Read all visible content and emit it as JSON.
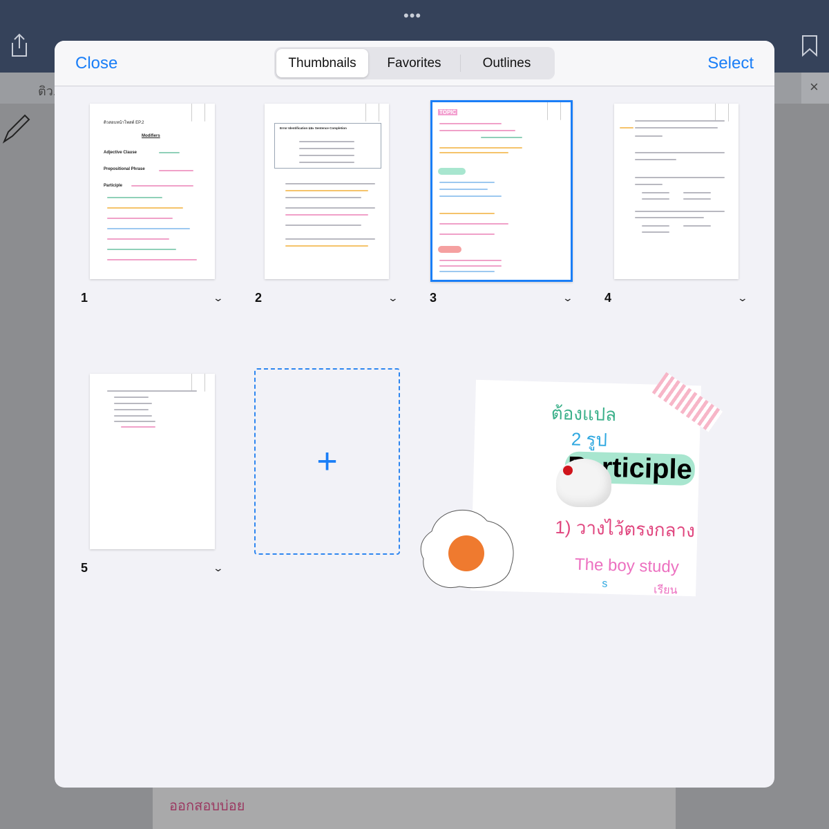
{
  "topbar": {
    "more_icon": "ellipsis-icon",
    "share_icon": "share-icon",
    "bookmark_icon": "bookmark-icon",
    "tab_title": "ติว...",
    "tab_close": "×",
    "doc_text": "ออกสอบบ่อย"
  },
  "modal": {
    "close_label": "Close",
    "select_label": "Select",
    "tabs": [
      {
        "label": "Thumbnails",
        "active": true
      },
      {
        "label": "Favorites",
        "active": false
      },
      {
        "label": "Outlines",
        "active": false
      }
    ],
    "pages": [
      {
        "number": "1",
        "headings": [
          "ติวสอบหน้าโพสต์ EP.2",
          "Modifiers",
          "Adjective Clause",
          "Prepositional Phrase",
          "Participle"
        ]
      },
      {
        "number": "2",
        "headings": [
          "Error Identification และ Sentence Completion"
        ]
      },
      {
        "number": "3",
        "selected": true,
        "headings": [
          "TOPIC"
        ]
      },
      {
        "number": "4",
        "headings": []
      },
      {
        "number": "5",
        "headings": []
      }
    ],
    "add_page_icon": "plus-icon",
    "sticker": {
      "line1": "ต้องแปล",
      "line2": "2 รูป",
      "title": "Participle",
      "item": "1) วางไว้ตรงกลาง",
      "example": "The boy study",
      "example_note": "เรียน",
      "s_mark": "s"
    },
    "accent_color": "#1a7ef7"
  }
}
